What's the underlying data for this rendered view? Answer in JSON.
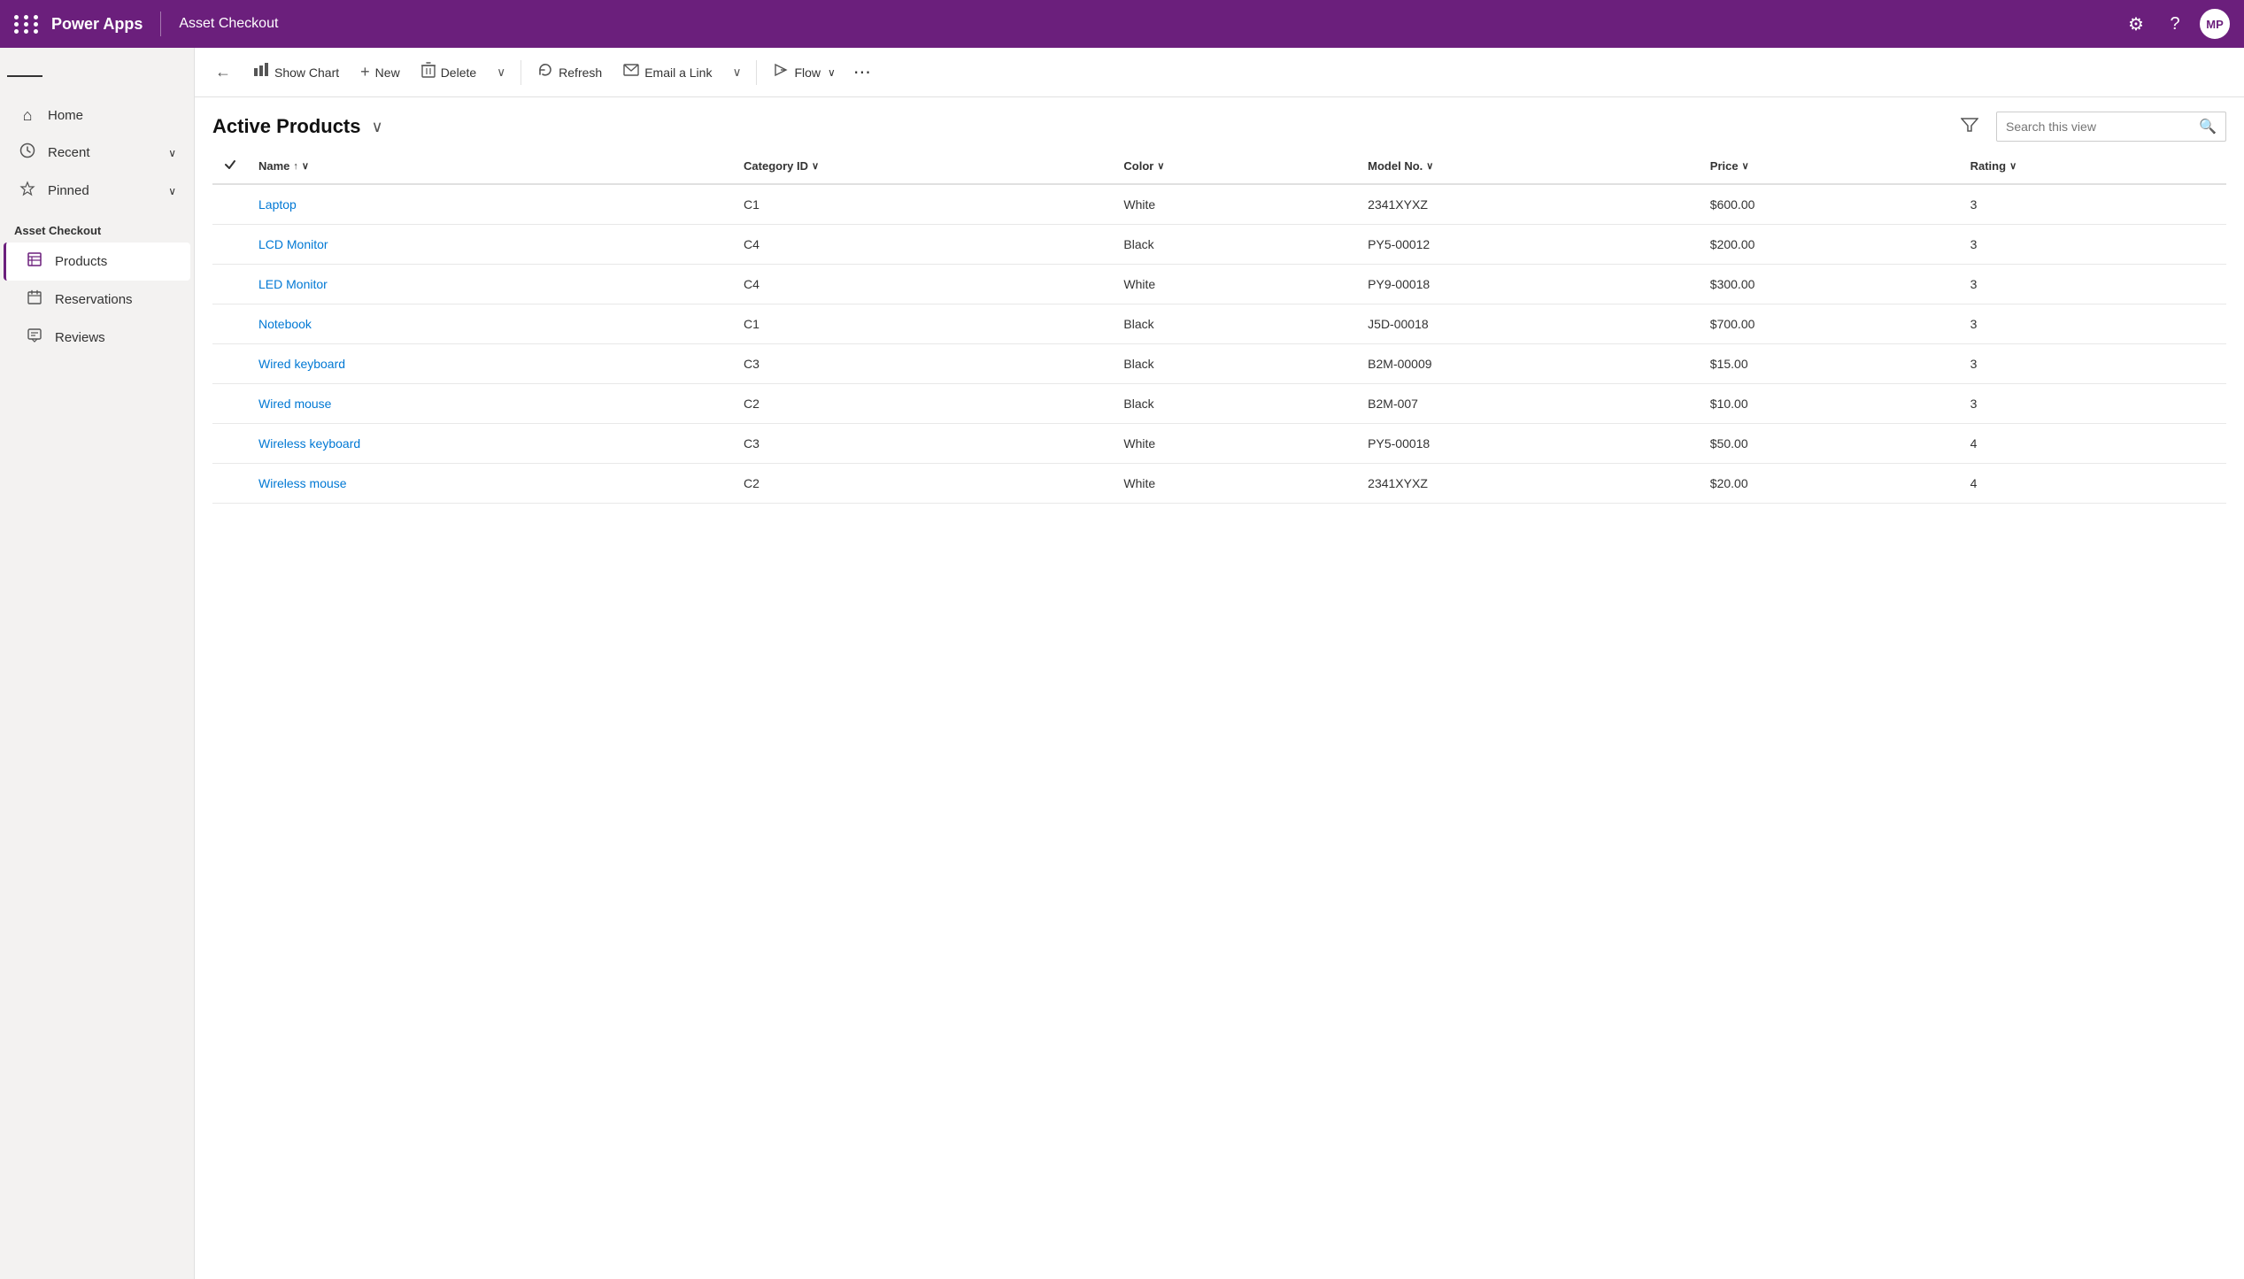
{
  "topbar": {
    "brand": "Power Apps",
    "app_name": "Asset Checkout",
    "avatar": "MP",
    "settings_icon": "⚙",
    "help_icon": "?"
  },
  "sidebar": {
    "nav_items": [
      {
        "id": "home",
        "label": "Home",
        "icon": "⌂",
        "has_chevron": false
      },
      {
        "id": "recent",
        "label": "Recent",
        "icon": "○",
        "has_chevron": true
      },
      {
        "id": "pinned",
        "label": "Pinned",
        "icon": "◇",
        "has_chevron": true
      }
    ],
    "section_title": "Asset Checkout",
    "app_nav_items": [
      {
        "id": "products",
        "label": "Products",
        "icon": "☰",
        "active": true
      },
      {
        "id": "reservations",
        "label": "Reservations",
        "icon": "☰",
        "active": false
      },
      {
        "id": "reviews",
        "label": "Reviews",
        "icon": "☰",
        "active": false
      }
    ]
  },
  "toolbar": {
    "back_label": "←",
    "show_chart_label": "Show Chart",
    "new_label": "New",
    "delete_label": "Delete",
    "refresh_label": "Refresh",
    "email_link_label": "Email a Link",
    "flow_label": "Flow",
    "more_label": "⋯"
  },
  "view": {
    "title": "Active Products",
    "search_placeholder": "Search this view"
  },
  "table": {
    "columns": [
      {
        "id": "name",
        "label": "Name",
        "sortable": true,
        "sort_dir": "asc",
        "has_chevron": true
      },
      {
        "id": "category_id",
        "label": "Category ID",
        "sortable": true
      },
      {
        "id": "color",
        "label": "Color",
        "sortable": true
      },
      {
        "id": "model_no",
        "label": "Model No.",
        "sortable": true
      },
      {
        "id": "price",
        "label": "Price",
        "sortable": true
      },
      {
        "id": "rating",
        "label": "Rating",
        "sortable": true
      }
    ],
    "rows": [
      {
        "name": "Laptop",
        "category_id": "C1",
        "color": "White",
        "model_no": "2341XYXZ",
        "price": "$600.00",
        "rating": "3"
      },
      {
        "name": "LCD Monitor",
        "category_id": "C4",
        "color": "Black",
        "model_no": "PY5-00012",
        "price": "$200.00",
        "rating": "3"
      },
      {
        "name": "LED Monitor",
        "category_id": "C4",
        "color": "White",
        "model_no": "PY9-00018",
        "price": "$300.00",
        "rating": "3"
      },
      {
        "name": "Notebook",
        "category_id": "C1",
        "color": "Black",
        "model_no": "J5D-00018",
        "price": "$700.00",
        "rating": "3"
      },
      {
        "name": "Wired keyboard",
        "category_id": "C3",
        "color": "Black",
        "model_no": "B2M-00009",
        "price": "$15.00",
        "rating": "3"
      },
      {
        "name": "Wired mouse",
        "category_id": "C2",
        "color": "Black",
        "model_no": "B2M-007",
        "price": "$10.00",
        "rating": "3"
      },
      {
        "name": "Wireless keyboard",
        "category_id": "C3",
        "color": "White",
        "model_no": "PY5-00018",
        "price": "$50.00",
        "rating": "4"
      },
      {
        "name": "Wireless mouse",
        "category_id": "C2",
        "color": "White",
        "model_no": "2341XYXZ",
        "price": "$20.00",
        "rating": "4"
      }
    ]
  }
}
